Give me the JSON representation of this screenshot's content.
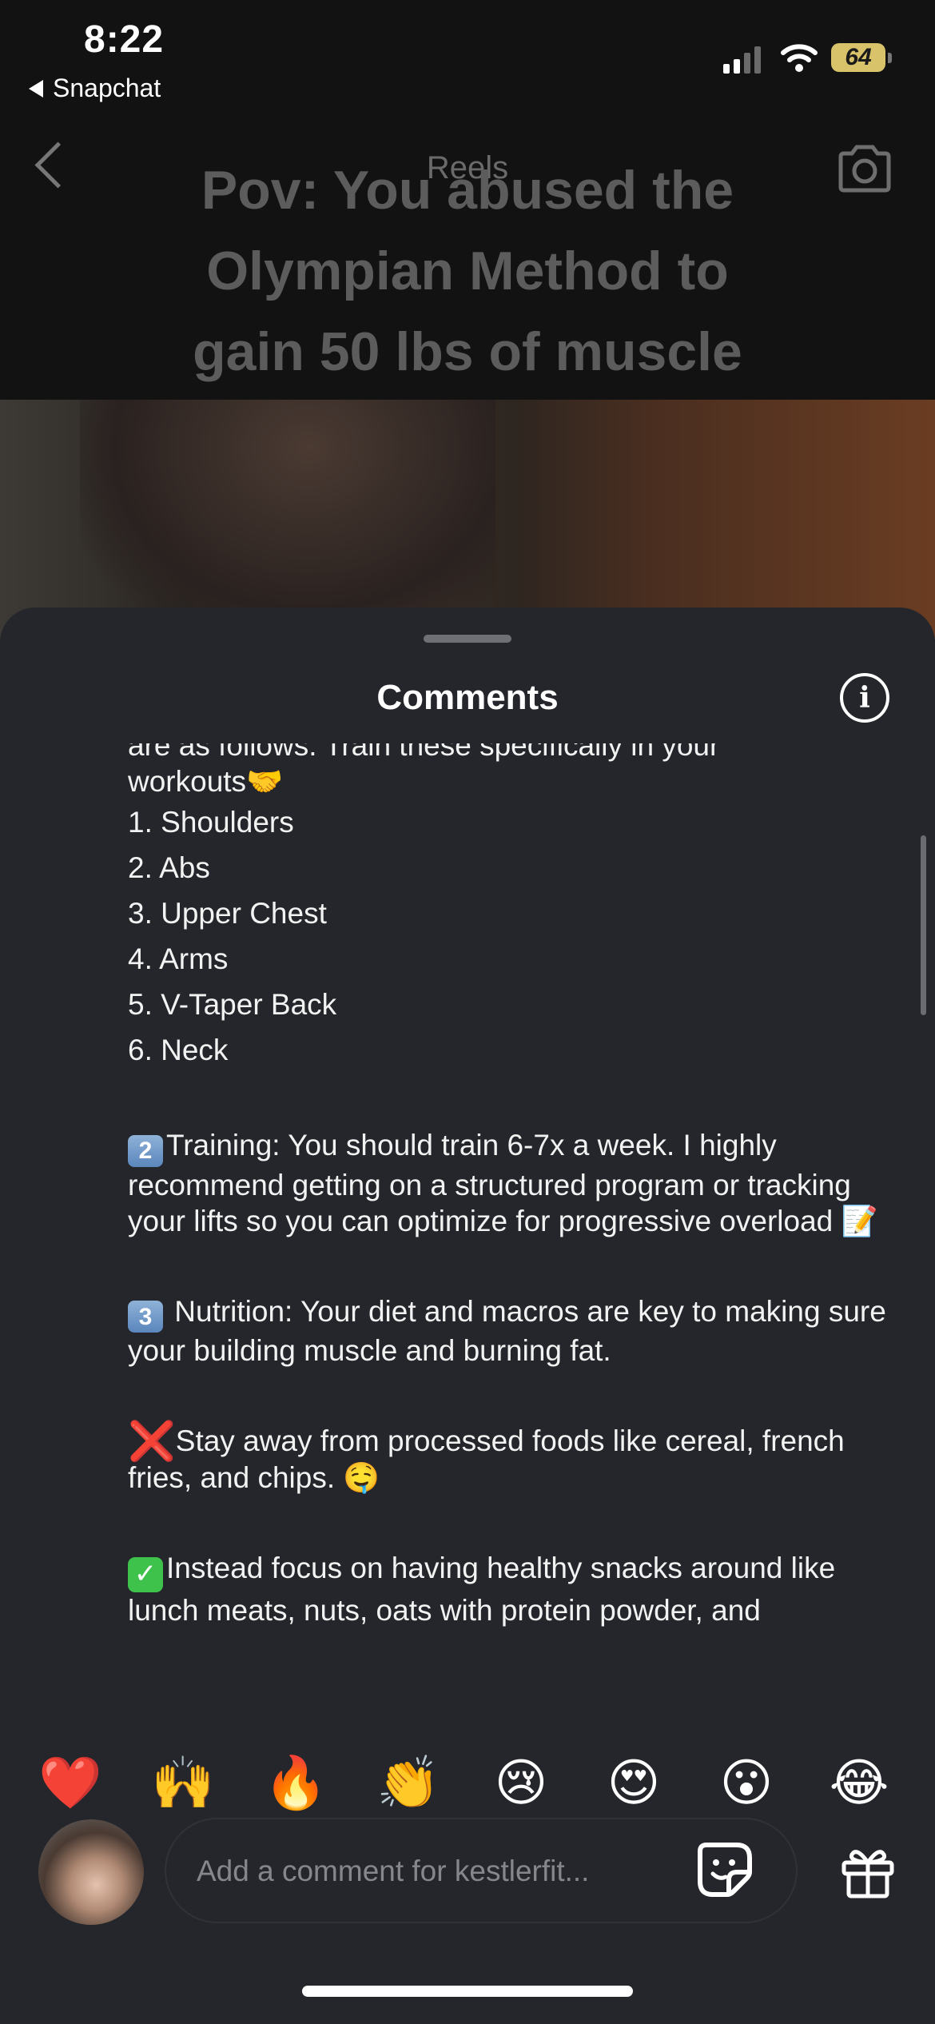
{
  "status_bar": {
    "time": "8:22",
    "back_app": "Snapchat",
    "battery": "64"
  },
  "reel": {
    "header_label": "Reels",
    "overlay_title": [
      "Pov: You abused the",
      "Olympian Method to",
      "gain 50 lbs of muscle"
    ]
  },
  "comments_sheet": {
    "title": "Comments",
    "comment": {
      "intro_lines": [
        "are as follows. Train these specifically in your",
        "workouts"
      ],
      "intro_emoji": "🤝",
      "list": [
        "1. Shoulders",
        "2. Abs",
        "3. Upper Chest",
        "4. Arms",
        "5. V-Taper Back",
        "6. Neck"
      ],
      "training_key": "2",
      "training": "Training: You should train 6-7x a week. I highly recommend getting on a structured program or tracking your lifts so you can optimize for progressive overload ",
      "training_emoji": "📝",
      "nutrition_key": "3",
      "nutrition": " Nutrition: Your diet and macros are key to making sure your building muscle and burning fat.",
      "avoid_mark": "❌",
      "avoid": "Stay away from processed foods like cereal, french fries, and chips. ",
      "avoid_emoji": "🤤",
      "instead_mark": "✓",
      "instead": "Instead focus on having healthy snacks around like lunch meats, nuts, oats with protein powder, and"
    },
    "reactions": [
      "❤️",
      "🙌",
      "🔥",
      "👏",
      "😢",
      "😍",
      "😮",
      "😂"
    ],
    "composer_placeholder": "Add a comment for kestlerfit..."
  },
  "colors": {
    "sheet_bg": "#24262b",
    "top_bg": "#0d0e10",
    "text": "#ffffff",
    "placeholder": "#85878c"
  }
}
